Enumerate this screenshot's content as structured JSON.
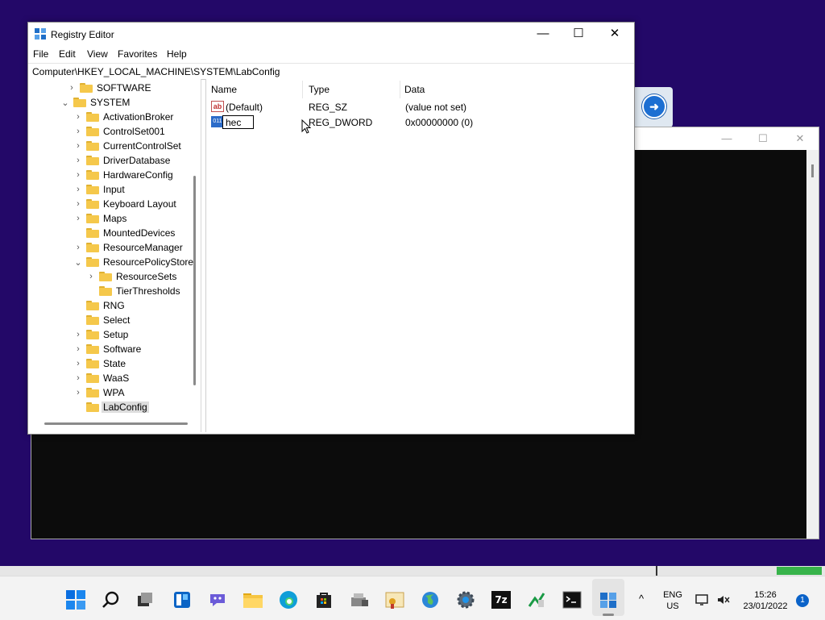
{
  "regedit": {
    "title": "Registry Editor",
    "controls": {
      "minimize": "—",
      "maximize": "☐",
      "close": "✕"
    },
    "menu": [
      "File",
      "Edit",
      "View",
      "Favorites",
      "Help"
    ],
    "address": "Computer\\HKEY_LOCAL_MACHINE\\SYSTEM\\LabConfig",
    "tree": [
      {
        "label": "SOFTWARE",
        "expander": "›"
      },
      {
        "label": "SYSTEM",
        "expander": "⌄"
      },
      {
        "label": "ActivationBroker",
        "expander": "›"
      },
      {
        "label": "ControlSet001",
        "expander": "›"
      },
      {
        "label": "CurrentControlSet",
        "expander": "›"
      },
      {
        "label": "DriverDatabase",
        "expander": "›"
      },
      {
        "label": "HardwareConfig",
        "expander": "›"
      },
      {
        "label": "Input",
        "expander": "›"
      },
      {
        "label": "Keyboard Layout",
        "expander": "›"
      },
      {
        "label": "Maps",
        "expander": "›"
      },
      {
        "label": "MountedDevices",
        "expander": ""
      },
      {
        "label": "ResourceManager",
        "expander": "›"
      },
      {
        "label": "ResourcePolicyStore",
        "expander": "⌄"
      },
      {
        "label": "ResourceSets",
        "expander": "›"
      },
      {
        "label": "TierThresholds",
        "expander": ""
      },
      {
        "label": "RNG",
        "expander": ""
      },
      {
        "label": "Select",
        "expander": ""
      },
      {
        "label": "Setup",
        "expander": "›"
      },
      {
        "label": "Software",
        "expander": "›"
      },
      {
        "label": "State",
        "expander": "›"
      },
      {
        "label": "WaaS",
        "expander": "›"
      },
      {
        "label": "WPA",
        "expander": "›"
      },
      {
        "label": "LabConfig",
        "expander": ""
      }
    ],
    "columns": {
      "name": "Name",
      "type": "Type",
      "data": "Data"
    },
    "values": [
      {
        "name": "(Default)",
        "type": "REG_SZ",
        "data": "(value not set)",
        "icon": "string-value-icon",
        "glyph": "ab"
      },
      {
        "name": "hec",
        "type": "REG_DWORD",
        "data": "0x00000000 (0)",
        "icon": "binary-value-icon",
        "glyph": "011"
      }
    ]
  },
  "console": {
    "controls": {
      "minimize": "—",
      "maximize": "☐",
      "close": "✕"
    }
  },
  "taskbar": {
    "icons": [
      "start-icon",
      "search-icon",
      "task-view-icon",
      "widgets-icon",
      "chat-icon",
      "file-explorer-icon",
      "edge-icon",
      "store-icon",
      "installer-icon",
      "certificate-icon",
      "globe-icon",
      "settings-icon",
      "7zip-icon",
      "green-app-icon",
      "terminal-icon",
      "regedit-icon"
    ],
    "seven_zip": "7z",
    "lang_top": "ENG",
    "lang_bottom": "US",
    "time": "15:26",
    "date": "23/01/2022",
    "notifications": "1",
    "chevron": "^"
  }
}
